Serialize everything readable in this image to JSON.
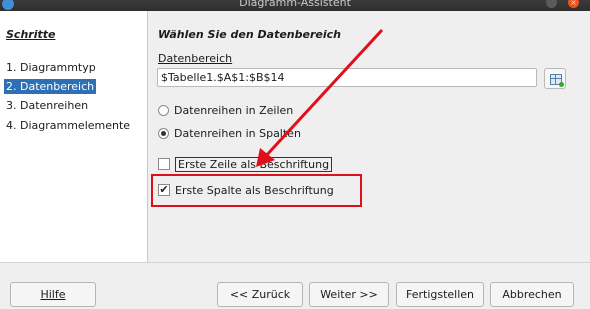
{
  "window": {
    "title": "Diagramm-Assistent"
  },
  "steps": {
    "heading": "Schritte",
    "items": [
      {
        "label": "1. Diagrammtyp",
        "selected": false
      },
      {
        "label": "2. Datenbereich",
        "selected": true
      },
      {
        "label": "3. Datenreihen",
        "selected": false
      },
      {
        "label": "4. Diagrammelemente",
        "selected": false
      }
    ]
  },
  "datarange": {
    "section_title": "Wählen Sie den Datenbereich",
    "label": "Datenbereich",
    "value": "$Tabelle1.$A$1:$B$14",
    "options": {
      "rows": {
        "label": "Datenreihen in Zeilen",
        "checked": false
      },
      "columns": {
        "label": "Datenreihen in Spalten",
        "checked": true
      },
      "first_row": {
        "label": "Erste Zeile als Beschriftung",
        "checked": false
      },
      "first_column": {
        "label": "Erste Spalte als Beschriftung",
        "checked": true
      }
    }
  },
  "buttons": {
    "help": "Hilfe",
    "back": "<< Zurück",
    "next": "Weiter >>",
    "finish": "Fertigstellen",
    "cancel": "Abbrechen"
  },
  "colors": {
    "selection": "#2f6fb3",
    "annotation": "#e0101a"
  }
}
